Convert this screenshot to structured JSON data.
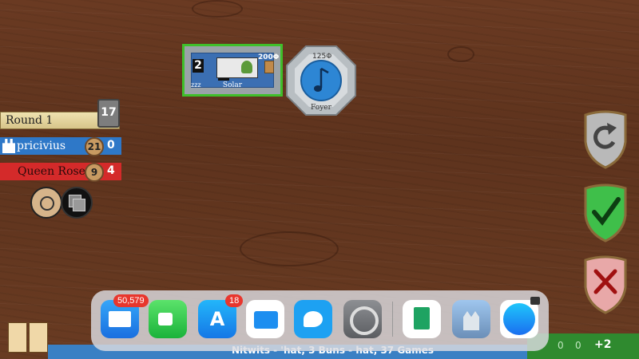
{
  "room_solar": {
    "cost": "200",
    "label": "Solar",
    "badge_a": "2",
    "badge_b": "2",
    "sleep": "zzz"
  },
  "room_foyer": {
    "cost": "125",
    "label": "Foyer"
  },
  "round": {
    "label": "Round 1",
    "turn": "17"
  },
  "players": [
    {
      "name": "pricivius",
      "coins": "21",
      "count": "0",
      "color": "#2e78c8"
    },
    {
      "name": "Queen Rose",
      "coins": "9",
      "count": "4",
      "color": "#d42a2a"
    }
  ],
  "actions": {
    "undo": "undo-icon",
    "confirm": "check-icon",
    "cancel": "x-icon"
  },
  "dock": {
    "apps": [
      {
        "name": "Mail",
        "badge": "50,579"
      },
      {
        "name": "FaceTime",
        "badge": ""
      },
      {
        "name": "App Store",
        "badge": "18"
      },
      {
        "name": "Files",
        "badge": ""
      },
      {
        "name": "Twitter",
        "badge": ""
      },
      {
        "name": "Settings",
        "badge": ""
      },
      {
        "name": "Sheets",
        "badge": ""
      },
      {
        "name": "Photo",
        "badge": ""
      },
      {
        "name": "Safari",
        "badge": ""
      }
    ]
  },
  "bottom": {
    "message": "Nitwits - 'hat, 3 Buns - hat, 37 Games",
    "score": "+2",
    "zero_a": "0",
    "zero_b": "0"
  }
}
